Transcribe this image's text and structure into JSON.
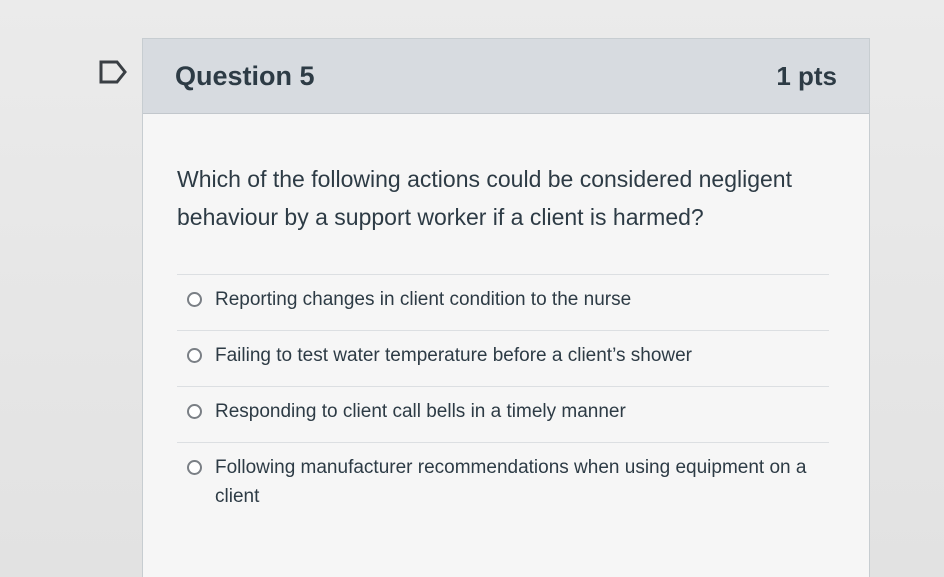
{
  "quiz": {
    "question": {
      "title": "Question 5",
      "points": "1 pts",
      "text": "Which of the following actions could be considered negligent behaviour by a support worker if a client is harmed?",
      "answers": [
        {
          "label": "Reporting changes in client condition to the nurse",
          "selected": false
        },
        {
          "label": "Failing to test water temperature before a client’s shower",
          "selected": false
        },
        {
          "label": "Responding to client call bells in a timely manner",
          "selected": false
        },
        {
          "label": "Following manufacturer recommendations when using equipment on a client",
          "selected": false
        }
      ]
    },
    "flag_icon": "flag-question-icon"
  },
  "colors": {
    "header_bg": "#d7dbe0",
    "card_bg": "#f6f6f6",
    "text": "#2d3b45",
    "border": "#c7cdd1"
  }
}
